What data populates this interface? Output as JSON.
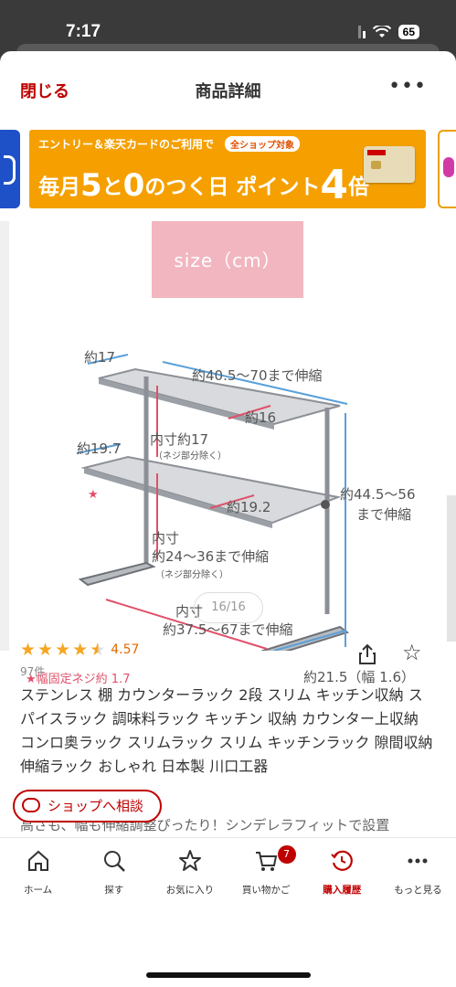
{
  "status_bar": {
    "time": "7:17",
    "battery": "65"
  },
  "header": {
    "close_label": "閉じる",
    "title": "商品詳細",
    "more_label": "•••"
  },
  "banner": {
    "line1": "エントリー＆楽天カードのご利用で",
    "tag": "全ショップ対象",
    "line2_a": "毎月",
    "num5": "5",
    "line2_b": "と",
    "num0": "0",
    "line2_c": "のつく日 ポイント",
    "num4": "4",
    "line2_d": "倍",
    "colors": {
      "background": "#f5a000",
      "text": "#ffffff"
    }
  },
  "gallery": {
    "size_title": "size（cm）",
    "dims": {
      "depth_top": "約17",
      "width_top": "約40.5～70まで伸縮",
      "inner_depth_top": "約16",
      "inner_height": "内寸約17",
      "inner_height_note": "（ネジ部分除く）",
      "depth_mid": "約19.7",
      "inner_depth_mid": "約19.2",
      "height_total": "約44.5～56",
      "height_total_2": "まで伸縮",
      "inner_width_label": "内寸",
      "inner_width": "約24～36まで伸縮",
      "inner_width_note": "（ネジ部分除く）",
      "inner_base_label": "内寸",
      "inner_base": "約37.5～67まで伸縮",
      "base_depth": "約21.5（幅 1.6）",
      "note": "★幅固定ネジ約 1.7"
    },
    "pager": "16/16"
  },
  "product": {
    "rating": "4.57",
    "review_count": "97件",
    "title": "ステンレス 棚 カウンターラック 2段 スリム キッチン収納 スパイスラック 調味料ラック キッチン 収納 カウンター上収納 コンロ奥ラック スリムラック スリム キッチンラック 隙間収納 伸縮ラック おしゃれ 日本製 川口工器",
    "subtitle": "高さも、幅も伸縮調整ぴったり！シンデレラフィットで設置",
    "consult_label": "ショップへ相談"
  },
  "tabbar": {
    "items": [
      {
        "label": "ホーム",
        "icon": "home-icon"
      },
      {
        "label": "探す",
        "icon": "search-icon"
      },
      {
        "label": "お気に入り",
        "icon": "star-icon"
      },
      {
        "label": "買い物かご",
        "icon": "cart-icon",
        "badge": "7"
      },
      {
        "label": "購入履歴",
        "icon": "history-icon"
      },
      {
        "label": "もっと見る",
        "icon": "more-icon"
      }
    ],
    "active_color": "#bf0000"
  }
}
